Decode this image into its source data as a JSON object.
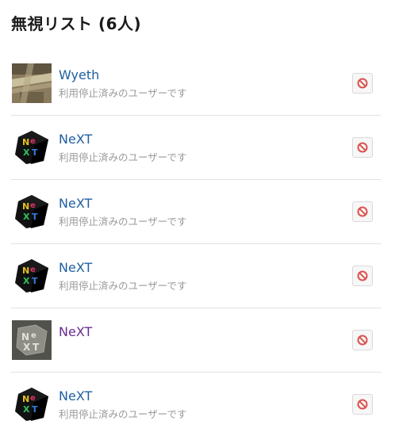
{
  "page": {
    "title": "無視リスト (6人)"
  },
  "users": [
    {
      "name": "Wyeth",
      "status": "利用停止済みのユーザーです",
      "avatar": "photo-avatar",
      "visited": false
    },
    {
      "name": "NeXT",
      "status": "利用停止済みのユーザーです",
      "avatar": "next-cube-logo",
      "visited": false
    },
    {
      "name": "NeXT",
      "status": "利用停止済みのユーザーです",
      "avatar": "next-cube-logo",
      "visited": false
    },
    {
      "name": "NeXT",
      "status": "利用停止済みのユーザーです",
      "avatar": "next-cube-logo",
      "visited": false
    },
    {
      "name": "NeXT",
      "status": "",
      "avatar": "next-glass-logo",
      "visited": true
    },
    {
      "name": "NeXT",
      "status": "利用停止済みのユーザーです",
      "avatar": "next-cube-logo",
      "visited": false
    }
  ],
  "icons": {
    "unblock": "prohibited-icon"
  },
  "colors": {
    "link": "#1f5fa0",
    "visited_link": "#6a2c91",
    "muted": "#9a9a9a",
    "danger": "#d9534f"
  }
}
